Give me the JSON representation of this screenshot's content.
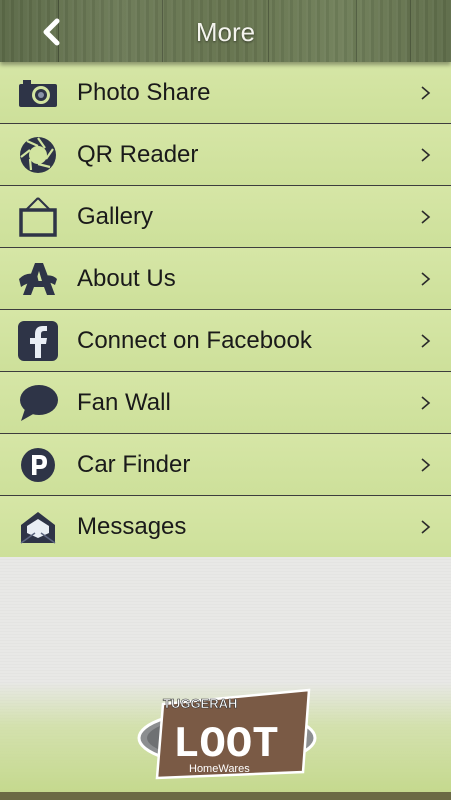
{
  "header": {
    "title": "More",
    "back_icon": "chevron-left-icon"
  },
  "menu": {
    "items": [
      {
        "label": "Photo Share",
        "icon": "camera-icon"
      },
      {
        "label": "QR Reader",
        "icon": "aperture-icon"
      },
      {
        "label": "Gallery",
        "icon": "picture-frame-icon"
      },
      {
        "label": "About Us",
        "icon": "letter-a-icon"
      },
      {
        "label": "Connect on Facebook",
        "icon": "facebook-icon"
      },
      {
        "label": "Fan Wall",
        "icon": "speech-bubble-icon"
      },
      {
        "label": "Car Finder",
        "icon": "parking-icon"
      },
      {
        "label": "Messages",
        "icon": "envelope-icon"
      }
    ]
  },
  "logo": {
    "top_text": "TUGGERAH",
    "main_text": "LOOT",
    "bottom_text": "HomeWares"
  },
  "colors": {
    "header_wood": "#66744f",
    "row_green": "#d2e4a0",
    "icon_navy": "#2e3447",
    "logo_brown": "#7a5a45"
  }
}
